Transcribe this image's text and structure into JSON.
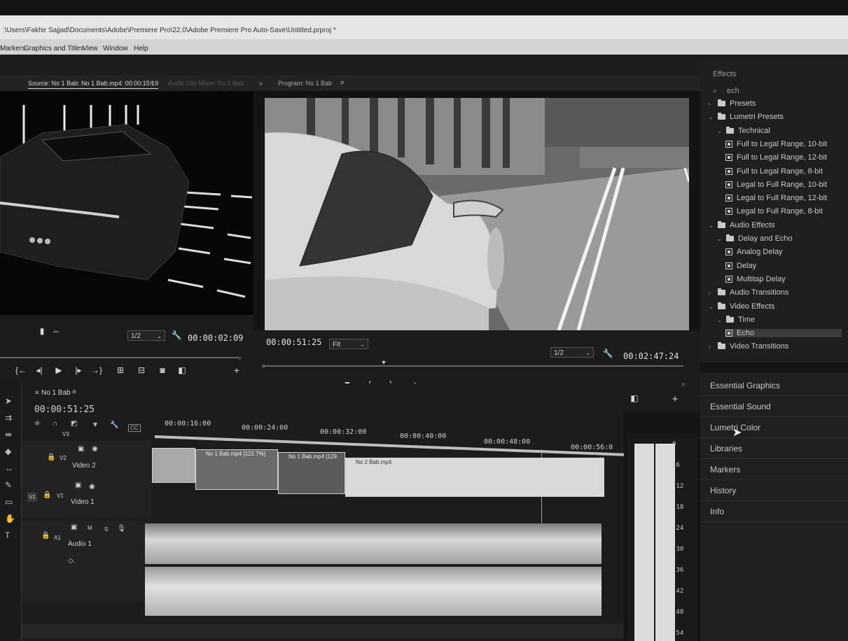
{
  "window": {
    "title": ":\\Users\\Fakhir Sajjad\\Documents\\Adobe\\Premiere Pro\\22.0\\Adobe Premiere Pro Auto-Save\\Untitled.prproj *"
  },
  "menu": [
    "Markers",
    "Graphics and Titles",
    "View",
    "Window",
    "Help"
  ],
  "tabs": {
    "source": "Source: No 1 Bab: No 1 Bab.mp4: 00:00:15:19",
    "audio_mixer": "Audio Clip Mixer: No 1 Bab",
    "program": "Program: No 1 Bab"
  },
  "source_monitor": {
    "resolution": "1/2",
    "timecode": "00:00:02:09"
  },
  "program_monitor": {
    "timecode_left": "00:00:51:25",
    "fit": "Fit",
    "resolution": "1/2",
    "timecode_right": "00:02:47:24"
  },
  "effects": {
    "title": "Effects",
    "search": "ech",
    "tree": [
      {
        "label": "Presets",
        "type": "folder",
        "level": 0,
        "expanded": false
      },
      {
        "label": "Lumetri Presets",
        "type": "folder",
        "level": 0,
        "expanded": true
      },
      {
        "label": "Technical",
        "type": "folder",
        "level": 1,
        "expanded": true
      },
      {
        "label": "Full to Legal Range, 10-bit",
        "type": "effect",
        "level": 2
      },
      {
        "label": "Full to Legal Range, 12-bit",
        "type": "effect",
        "level": 2
      },
      {
        "label": "Full to Legal Range, 8-bit",
        "type": "effect",
        "level": 2
      },
      {
        "label": "Legal to Full Range, 10-bit",
        "type": "effect",
        "level": 2
      },
      {
        "label": "Legal to Full Range, 12-bit",
        "type": "effect",
        "level": 2
      },
      {
        "label": "Legal to Full Range, 8-bit",
        "type": "effect",
        "level": 2
      },
      {
        "label": "Audio Effects",
        "type": "folder",
        "level": 0,
        "expanded": true
      },
      {
        "label": "Delay and Echo",
        "type": "folder",
        "level": 1,
        "expanded": true
      },
      {
        "label": "Analog Delay",
        "type": "effect",
        "level": 2
      },
      {
        "label": "Delay",
        "type": "effect",
        "level": 2
      },
      {
        "label": "Multitap Delay",
        "type": "effect",
        "level": 2
      },
      {
        "label": "Audio Transitions",
        "type": "folder",
        "level": 0,
        "expanded": false
      },
      {
        "label": "Video Effects",
        "type": "folder",
        "level": 0,
        "expanded": true
      },
      {
        "label": "Time",
        "type": "folder",
        "level": 1,
        "expanded": true
      },
      {
        "label": "Echo",
        "type": "effect",
        "level": 2,
        "selected": true
      },
      {
        "label": "Video Transitions",
        "type": "folder",
        "level": 0,
        "expanded": false
      }
    ]
  },
  "panels": [
    "Essential Graphics",
    "Essential Sound",
    "Lumetri Color",
    "Libraries",
    "Markers",
    "History",
    "Info"
  ],
  "timeline": {
    "sequence": "No 1 Bab",
    "timecode": "00:00:51:25",
    "ruler": [
      "00:00:16:00",
      "00:00:24:00",
      "00:00:32:00",
      "00:00:40:00",
      "00:00:48:00",
      "00:00:56:0"
    ],
    "tracks": {
      "v3": "V3",
      "v2": "V2",
      "v2_name": "Video 2",
      "v1": "V1",
      "v1_name": "Video 1",
      "a1": "A1",
      "a1_name": "Audio 1",
      "m": "M",
      "s": "S"
    },
    "clips": [
      "No 1 Bab.mp4 [122.7%]",
      "No 1 Bab.mp4 [129",
      "No 2 Bab.mp4"
    ]
  },
  "meters": [
    "0",
    "-6",
    "-12",
    "-18",
    "-24",
    "-30",
    "-36",
    "-42",
    "-48",
    "-54"
  ]
}
